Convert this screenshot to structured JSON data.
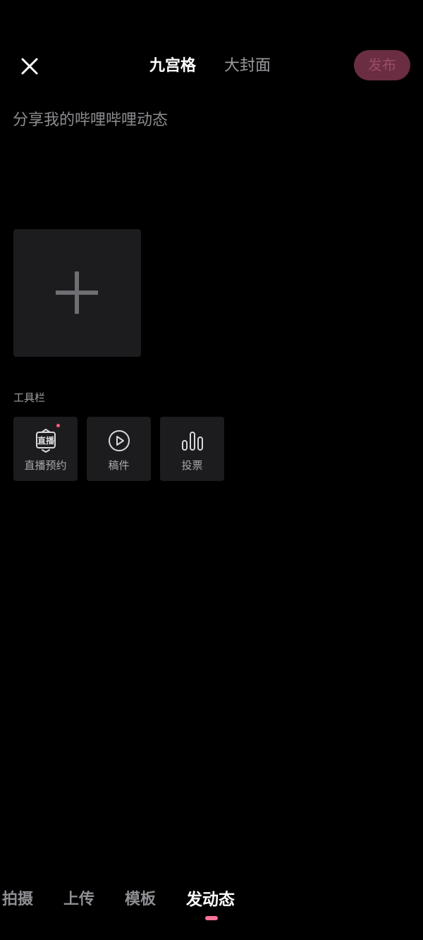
{
  "header": {
    "close_icon": "close-icon",
    "tabs": [
      {
        "label": "九宫格",
        "active": true
      },
      {
        "label": "大封面",
        "active": false
      }
    ],
    "publish_label": "发布"
  },
  "composer": {
    "placeholder": "分享我的哔哩哔哩动态",
    "value": "",
    "add_image_icon": "plus-icon"
  },
  "toolbar": {
    "title": "工具栏",
    "items": [
      {
        "label": "直播预约",
        "icon": "live-reserve-icon",
        "icon_text": "直播",
        "has_dot": true
      },
      {
        "label": "稿件",
        "icon": "play-circle-icon"
      },
      {
        "label": "投票",
        "icon": "poll-bars-icon"
      }
    ]
  },
  "bottom_nav": {
    "items": [
      {
        "label": "拍摄",
        "active": false
      },
      {
        "label": "上传",
        "active": false
      },
      {
        "label": "模板",
        "active": false
      },
      {
        "label": "发动态",
        "active": true
      }
    ]
  },
  "colors": {
    "background": "#000000",
    "card": "#1c1c1e",
    "accent": "#fb7299",
    "publish_disabled_bg": "#6a2d42"
  }
}
